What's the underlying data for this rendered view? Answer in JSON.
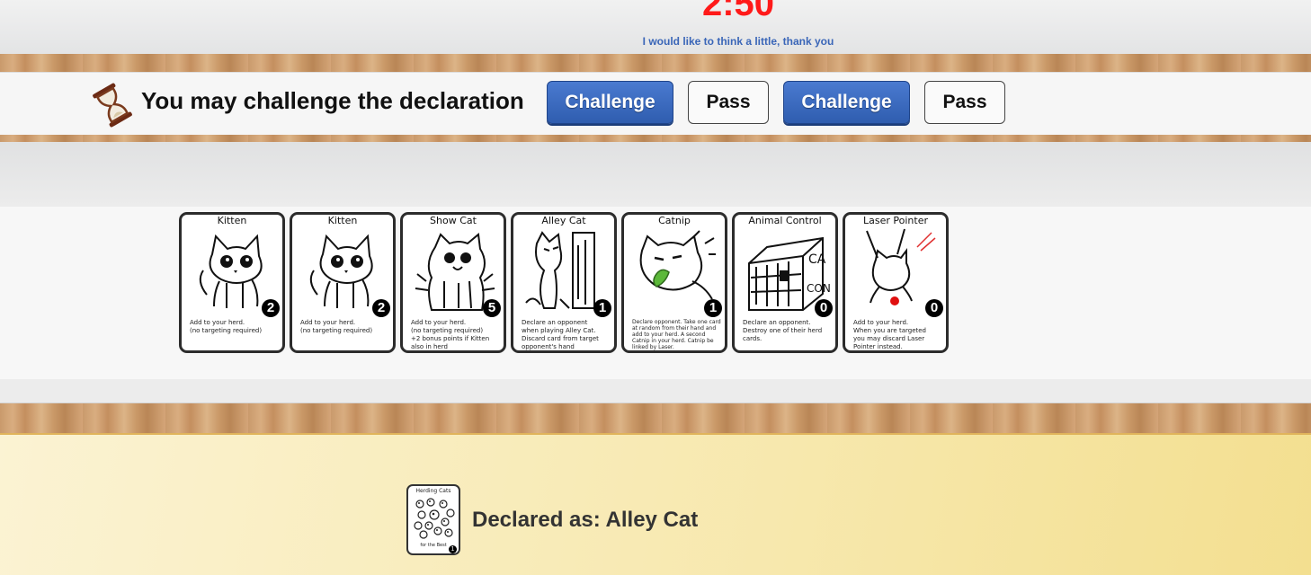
{
  "timer": {
    "value": "2:50",
    "color": "#ff1a1a"
  },
  "opponent_status": "I would like to think a little, thank you",
  "action_bar": {
    "icon": "hourglass-icon",
    "prompt": "You may challenge the declaration",
    "buttons": [
      {
        "label": "Challenge",
        "style": "primary",
        "color": "#3462b7"
      },
      {
        "label": "Pass",
        "style": "secondary"
      },
      {
        "label": "Challenge",
        "style": "primary",
        "color": "#3462b7"
      },
      {
        "label": "Pass",
        "style": "secondary"
      }
    ]
  },
  "hand": {
    "cards": [
      {
        "name": "Kitten",
        "value": "2",
        "art": "kitten-icon",
        "description": "Add to your herd.\n(no targeting required)"
      },
      {
        "name": "Kitten",
        "value": "2",
        "art": "kitten-icon",
        "description": "Add to your herd.\n(no targeting required)"
      },
      {
        "name": "Show Cat",
        "value": "5",
        "art": "show-cat-icon",
        "description": "Add to your herd.\n(no targeting required)\n+2 bonus points if Kitten\nalso in herd"
      },
      {
        "name": "Alley Cat",
        "value": "1",
        "art": "alley-cat-icon",
        "description": "Declare an opponent\nwhen playing Alley Cat.\nDiscard card from target\nopponent's hand"
      },
      {
        "name": "Catnip",
        "value": "1",
        "art": "catnip-icon",
        "description": "Declare opponent. Take one card at random from their hand and add to your herd. A second Catnip in your herd. Catnip be linked by Laser."
      },
      {
        "name": "Animal Control",
        "value": "0",
        "art": "animal-control-icon",
        "description": "Declare an opponent.\nDestroy one of their herd\ncards."
      },
      {
        "name": "Laser Pointer",
        "value": "0",
        "art": "laser-pointer-icon",
        "description": "Add to your herd.\nWhen you are targeted\nyou may discard Laser\nPointer instead."
      }
    ]
  },
  "declaration": {
    "card": {
      "title": "Herding Cats",
      "subtitle": "for the Best",
      "value": "1",
      "art": "card-back-icon"
    },
    "text": "Declared as: Alley Cat"
  }
}
